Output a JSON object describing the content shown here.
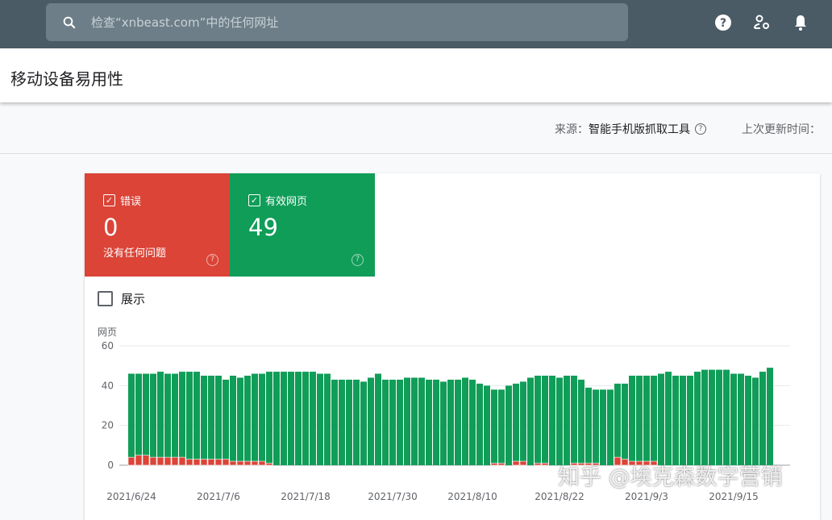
{
  "search": {
    "placeholder": "检查“xnbeast.com”中的任何网址",
    "icon": "search-icon"
  },
  "header_icons": [
    "help-icon",
    "manage-users-icon",
    "notifications-icon"
  ],
  "page_title": "移动设备易用性",
  "source": {
    "label": "来源：",
    "value": "智能手机版抓取工具",
    "last_updated_label": "上次更新时间："
  },
  "tiles": [
    {
      "label": "错误",
      "value": "0",
      "subtitle": "没有任何问题",
      "color": "#db4437",
      "checked": true
    },
    {
      "label": "有效网页",
      "value": "49",
      "color": "#109d58",
      "checked": true
    }
  ],
  "show_toggle": {
    "label": "展示",
    "checked": false
  },
  "watermark": "知乎 @埃克森数字营销",
  "chart_data": {
    "type": "bar",
    "stacked": true,
    "ylabel": "网页",
    "ylim": [
      0,
      60
    ],
    "yticks": [
      "0",
      "20",
      "40",
      "60"
    ],
    "xtick_labels": [
      {
        "index": 0,
        "label": "2021/6/24"
      },
      {
        "index": 12,
        "label": "2021/7/6"
      },
      {
        "index": 24,
        "label": "2021/7/18"
      },
      {
        "index": 36,
        "label": "2021/7/30"
      },
      {
        "index": 47,
        "label": "2021/8/10"
      },
      {
        "index": 59,
        "label": "2021/8/22"
      },
      {
        "index": 71,
        "label": "2021/9/3"
      },
      {
        "index": 83,
        "label": "2021/9/15"
      }
    ],
    "series": [
      {
        "name": "错误",
        "color": "#db4437",
        "values": [
          4,
          5,
          5,
          4,
          4,
          4,
          4,
          4,
          3,
          3,
          3,
          3,
          3,
          3,
          2,
          2,
          2,
          2,
          2,
          1,
          0,
          0,
          0,
          0,
          0,
          0,
          0,
          0,
          0,
          0,
          0,
          0,
          0,
          0,
          0,
          0,
          0,
          0,
          0,
          0,
          0,
          0,
          0,
          0,
          0,
          0,
          0,
          0,
          0,
          0,
          1,
          1,
          0,
          2,
          2,
          0,
          1,
          1,
          0,
          0,
          0,
          1,
          1,
          1,
          1,
          0,
          0,
          4,
          3,
          2,
          2,
          2,
          2,
          0,
          0,
          0,
          0,
          0,
          0,
          0,
          0,
          0,
          0,
          0,
          0,
          0,
          0,
          0,
          0
        ]
      },
      {
        "name": "有效网页",
        "color": "#109d58",
        "values": [
          42,
          41,
          41,
          42,
          43,
          42,
          42,
          43,
          44,
          44,
          42,
          42,
          42,
          40,
          43,
          42,
          43,
          44,
          44,
          46,
          47,
          47,
          47,
          47,
          47,
          47,
          46,
          46,
          43,
          43,
          43,
          43,
          42,
          44,
          46,
          43,
          43,
          43,
          44,
          44,
          44,
          43,
          43,
          42,
          43,
          43,
          44,
          43,
          41,
          40,
          37,
          37,
          40,
          39,
          40,
          44,
          44,
          44,
          45,
          44,
          45,
          44,
          42,
          38,
          37,
          38,
          38,
          37,
          38,
          43,
          43,
          43,
          43,
          46,
          47,
          45,
          45,
          45,
          47,
          48,
          48,
          48,
          48,
          46,
          46,
          45,
          44,
          47,
          49
        ]
      }
    ]
  }
}
